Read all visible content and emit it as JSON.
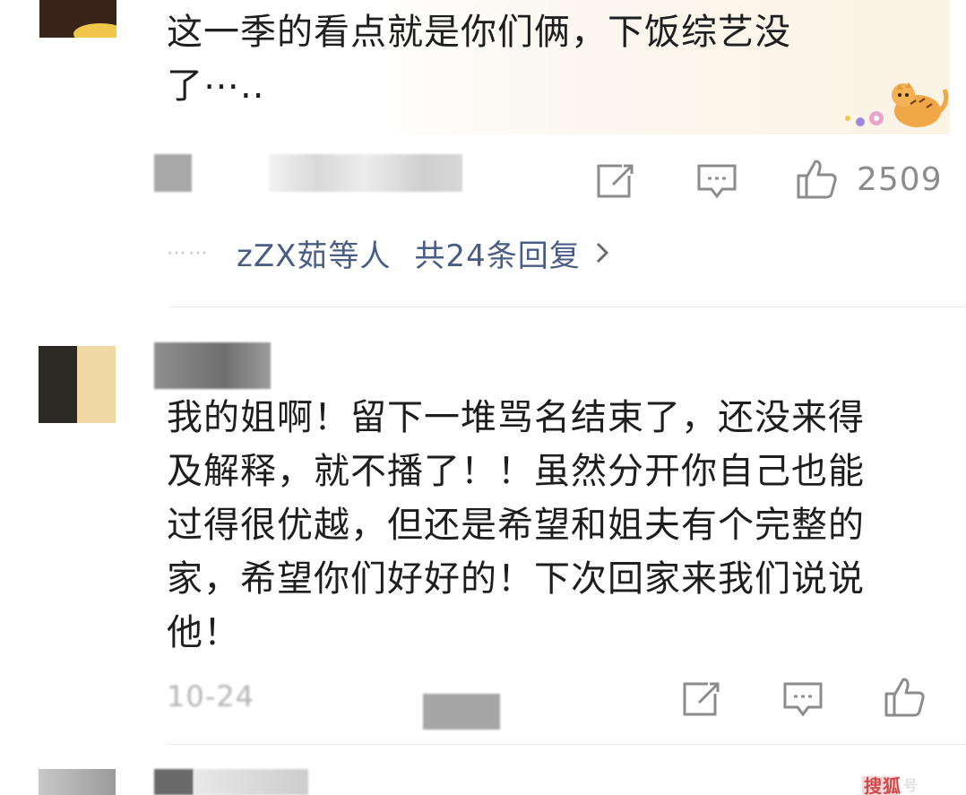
{
  "comments": [
    {
      "text_lines": [
        "这一季的看点就是你们俩，下饭综艺没",
        "了⋯.."
      ],
      "like_count": "2509",
      "reply_summary": {
        "names": "zZX茹等人",
        "count": "共24条回复"
      },
      "icons": {
        "repost": "repost-icon",
        "comment": "comment-icon",
        "like": "like-icon"
      }
    },
    {
      "text_lines": [
        "我的姐啊！留下一堆骂名结束了，还没来得",
        "及解释，就不播了！！虽然分开你自己也能",
        "过得很优越，但还是希望和姐夫有个完整的",
        "家，希望你们好好的！下次回家来我们说说",
        "他！"
      ],
      "timestamp": "10-24",
      "icons": {
        "repost": "repost-icon",
        "comment": "comment-icon",
        "like": "like-icon"
      }
    }
  ],
  "colors": {
    "link": "#4a5d86",
    "icon": "#8c8c8c",
    "text": "#1e1e1e",
    "divider": "#e9e9e9"
  }
}
